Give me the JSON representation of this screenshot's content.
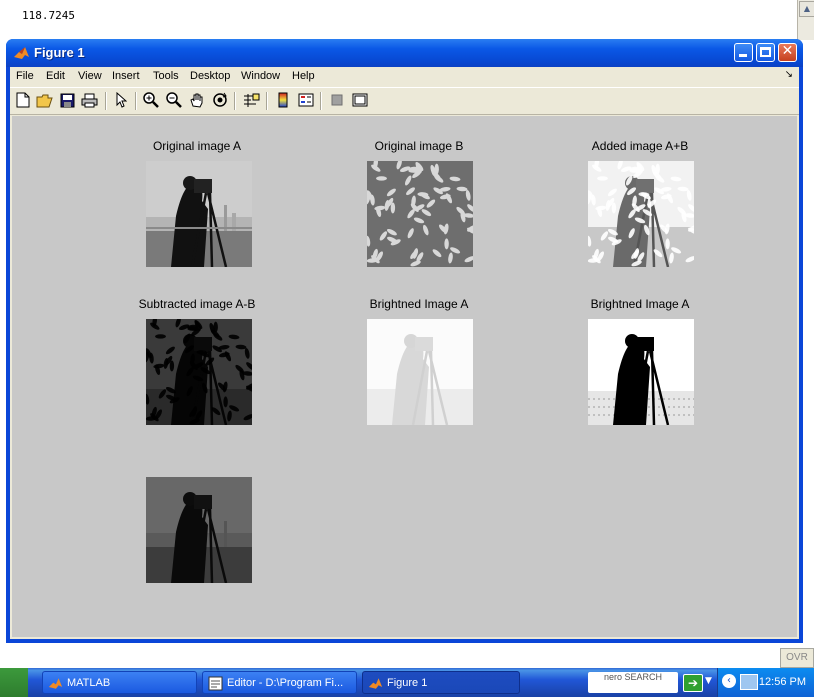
{
  "command_window": {
    "output_value": "118.7245",
    "status": "OVR"
  },
  "figure_window": {
    "title": "Figure 1",
    "menu": [
      "File",
      "Edit",
      "View",
      "Insert",
      "Tools",
      "Desktop",
      "Window",
      "Help"
    ],
    "toolbar_icons": [
      "new-figure-icon",
      "open-file-icon",
      "save-icon",
      "print-icon",
      "select-arrow-icon",
      "zoom-in-icon",
      "zoom-out-icon",
      "pan-hand-icon",
      "rotate-3d-icon",
      "data-cursor-icon",
      "colorbar-icon",
      "legend-icon",
      "hide-plot-tools-icon",
      "show-plot-tools-icon"
    ],
    "subplots": [
      {
        "title": "Original image A",
        "image": "cameraman"
      },
      {
        "title": "Original image B",
        "image": "rice"
      },
      {
        "title": "Added image A+B",
        "image": "cameraman-plus-rice"
      },
      {
        "title": "Subtracted image A-B",
        "image": "cameraman-minus-rice"
      },
      {
        "title": "Brightned Image A",
        "image": "cameraman-brightened"
      },
      {
        "title": "Brightned Image A",
        "image": "cameraman-high-contrast"
      },
      {
        "title": "",
        "image": "cameraman-darkened"
      }
    ]
  },
  "taskbar": {
    "tasks": [
      "MATLAB",
      "Editor - D:\\Program Fi...",
      "Figure 1"
    ],
    "clock": "12:56 PM",
    "nero_text": "nero SEARCH",
    "colors": {
      "taskbar": "#2157d7",
      "active_task": "#1e4cc0",
      "tray": "#0e62d5"
    }
  },
  "colors": {
    "figure_background": "#c8c8c8",
    "titlebar": "#0a58e6",
    "window_frame": "#ece9d8"
  }
}
